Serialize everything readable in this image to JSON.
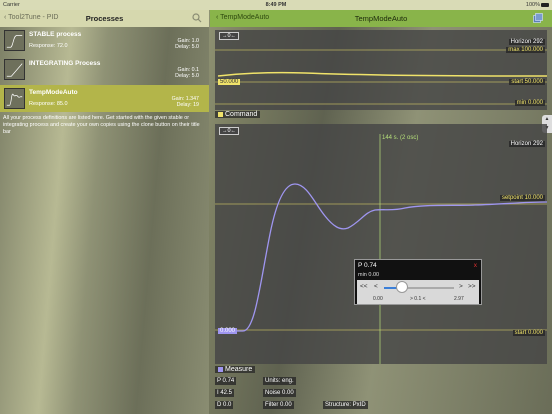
{
  "status": {
    "carrier": "Carrier",
    "time": "8:49 PM",
    "battery": "100%"
  },
  "left": {
    "back": "Tool2Tune - PID",
    "title": "Processes",
    "items": [
      {
        "name": "STABLE process",
        "response": "Response: 72.0",
        "gain": "Gain: 1.0",
        "delay": "Delay: 5.0"
      },
      {
        "name": "INTEGRATING Process",
        "response": "",
        "gain": "Gain: 0.1",
        "delay": "Delay: 5.0"
      },
      {
        "name": "TempModeAuto",
        "response": "Response: 85.0",
        "gain": "Gain: 1.347",
        "delay": "Delay: 19"
      }
    ],
    "help": "All your process definitions are listed here. Get started with the given stable or integrating process and create your own copies using the clone button on their title bar"
  },
  "right": {
    "back": "TempModeAuto",
    "title": "TempModeAuto",
    "top_plot": {
      "zoom": "→0←",
      "horizon": "Horizon 292",
      "max": "max 100.000",
      "current": "50.000",
      "start": "start 50.000",
      "min": "min 0.000"
    },
    "command_legend": "Command",
    "main_plot": {
      "zoom": "→0←",
      "cursor": "144 s. (2 osc)",
      "horizon": "Horizon 292",
      "setpoint": "setpoint 10.000",
      "start": "start 0.000",
      "current": "0.000"
    },
    "measure_legend": "Measure",
    "params": {
      "p": "P 0.74",
      "i": "I 42.5",
      "d": "D 0.0",
      "units": "Units: eng.",
      "noise": "Noise 0.00",
      "filter": "Filter 0.00",
      "structure": "Structure: PxID"
    },
    "popup": {
      "title": "P 0.74",
      "close": "x",
      "min": "min 0.00",
      "left2": "<<",
      "left1": "<",
      "right1": ">",
      "right2": ">>",
      "low": "0.00",
      "mid": "> 0.1 <",
      "high": "2.97",
      "level": 0.25
    }
  },
  "colors": {
    "command": "#f0e36a",
    "measure": "#9f96f0",
    "nav_left": "#d6d8ae",
    "nav_right": "#89b44a"
  }
}
